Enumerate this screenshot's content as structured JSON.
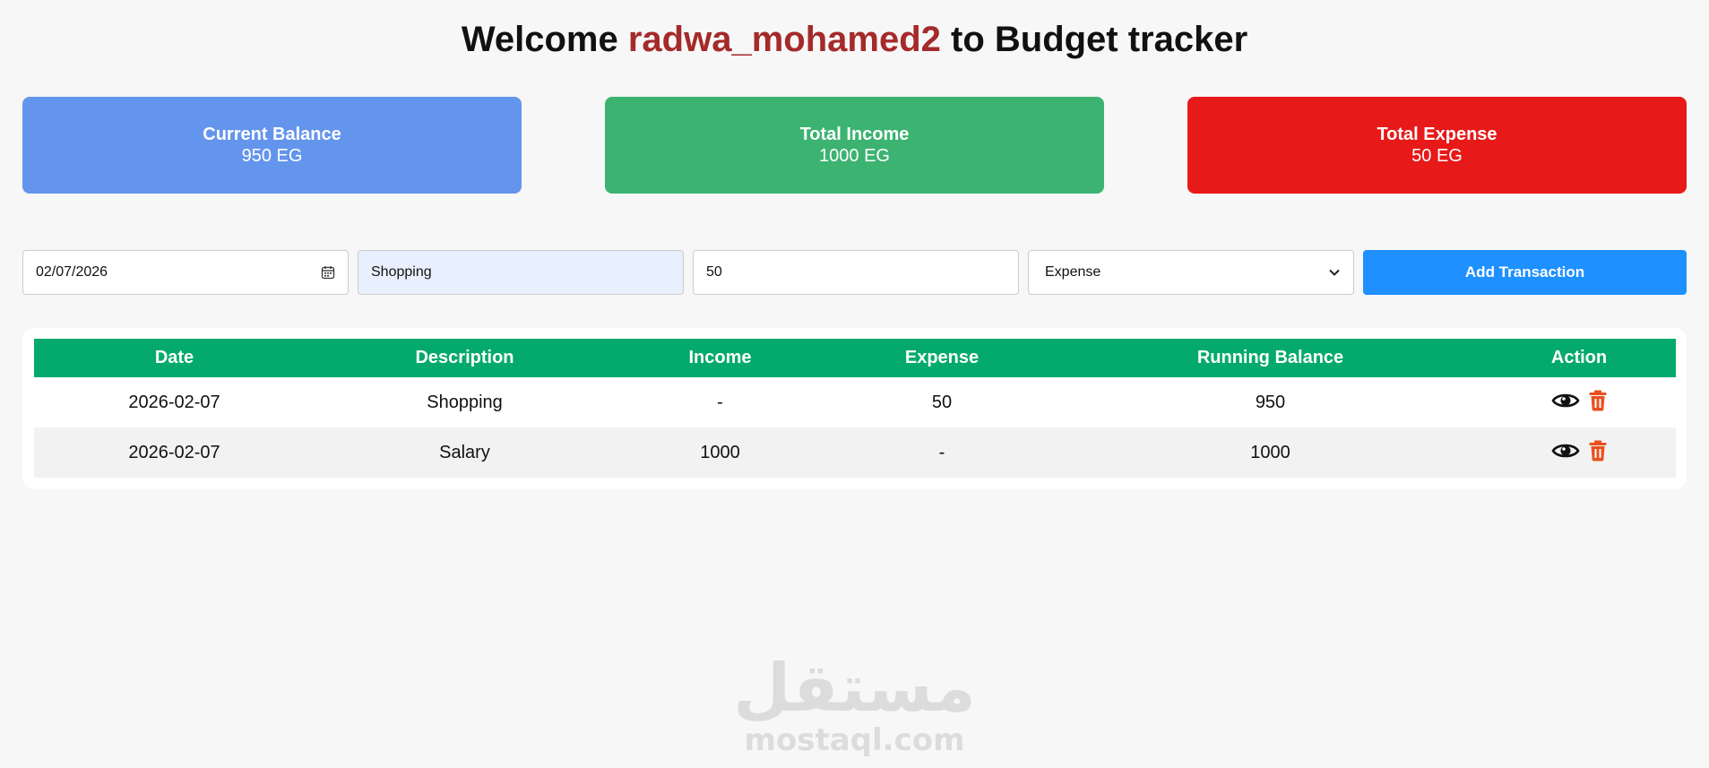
{
  "header": {
    "welcome": "Welcome",
    "username": "radwa_mohamed2",
    "suffix": "to Budget tracker"
  },
  "cards": {
    "balance": {
      "label": "Current Balance",
      "amount": "950 EG",
      "color": "#6495ed"
    },
    "income": {
      "label": "Total Income",
      "amount": "1000 EG",
      "color": "#3cb371"
    },
    "expense": {
      "label": "Total Expense",
      "amount": "50 EG",
      "color": "#e81919"
    }
  },
  "form": {
    "date_value": "02/07/2026",
    "description_value": "Shopping",
    "amount_value": "50",
    "type_selected": "Expense",
    "add_label": "Add Transaction"
  },
  "table": {
    "headers": [
      "Date",
      "Description",
      "Income",
      "Expense",
      "Running Balance",
      "Action"
    ],
    "rows": [
      {
        "date": "2026-02-07",
        "description": "Shopping",
        "income": "-",
        "expense": "50",
        "balance": "950"
      },
      {
        "date": "2026-02-07",
        "description": "Salary",
        "income": "1000",
        "expense": "-",
        "balance": "1000"
      }
    ]
  },
  "icons": {
    "view": "eye-icon",
    "delete": "trash-icon",
    "calendar": "calendar-icon",
    "dropdown": "chevron-down-icon"
  },
  "colors": {
    "username": "#a52a2a",
    "table_header": "#04aa6d",
    "button": "#1e90ff",
    "delete_icon": "#e8501e"
  },
  "watermark": {
    "arabic": "مستقل",
    "latin": "mostaql.com"
  }
}
